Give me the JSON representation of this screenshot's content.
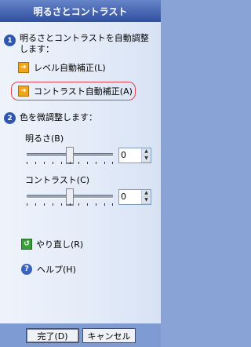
{
  "title": "明るさとコントラスト",
  "step1": {
    "number": "1",
    "text_line1": "明るさとコントラストを自動調整",
    "text_line2": "します：",
    "option_level": "レベル自動補正(L)",
    "option_contrast": "コントラスト自動補正(A)"
  },
  "step2": {
    "number": "2",
    "text": "色を微調整します：",
    "brightness_label": "明るさ(B)",
    "brightness_value": "0",
    "contrast_label": "コントラスト(C)",
    "contrast_value": "0"
  },
  "slider_levels": {
    "brightness": 0.5,
    "contrast": 0.5
  },
  "redo_label": "やり直し(R)",
  "help_label": "ヘルプ(H)",
  "buttons": {
    "ok": "完了(D)",
    "cancel": "キャンセル"
  },
  "colors": {
    "accent": "#2f57b2",
    "highlight": "#e0434d"
  },
  "icons": {
    "option_arrow": "orange-arrow-icon",
    "redo": "green-redo-icon",
    "help": "question-help-icon"
  }
}
